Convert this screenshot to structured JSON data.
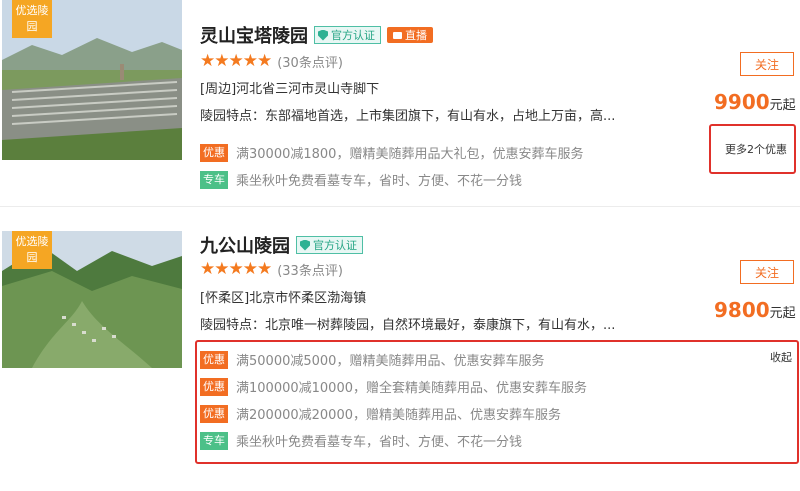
{
  "cards": [
    {
      "tag": "优选陵园",
      "name": "灵山宝塔陵园",
      "auth_label": "官方认证",
      "live_label": "直播",
      "stars": "★★★★★",
      "reviews": "(30条点评)",
      "address": "[周边]河北省三河市灵山寺脚下",
      "feature": "陵园特点：东部福地首选，上市集团旗下，有山有水，占地上万亩，高...",
      "promos": [
        {
          "label": "优惠",
          "text": "满30000减1800，赠精美随葬用品大礼包，优惠安葬车服务"
        },
        {
          "label": "专车",
          "text": "乘坐秋叶免费看墓专车，省时、方便、不花一分钱"
        }
      ],
      "follow": "关注",
      "price": "9900",
      "price_unit": "元起",
      "more": "更多2个优惠"
    },
    {
      "tag": "优选陵园",
      "name": "九公山陵园",
      "auth_label": "官方认证",
      "stars": "★★★★★",
      "reviews": "(33条点评)",
      "address": "[怀柔区]北京市怀柔区渤海镇",
      "feature": "陵园特点：北京唯一树葬陵园，自然环境最好，泰康旗下，有山有水，...",
      "promos": [
        {
          "label": "优惠",
          "text": "满50000减5000，赠精美随葬用品、优惠安葬车服务"
        },
        {
          "label": "优惠",
          "text": "满100000减10000，赠全套精美随葬用品、优惠安葬车服务"
        },
        {
          "label": "优惠",
          "text": "满200000减20000，赠精美随葬用品、优惠安葬车服务"
        },
        {
          "label": "专车",
          "text": "乘坐秋叶免费看墓专车，省时、方便、不花一分钱"
        }
      ],
      "follow": "关注",
      "price": "9800",
      "price_unit": "元起",
      "collapse": "收起"
    }
  ],
  "colors": {
    "accent": "#f26d22",
    "green": "#4cc088",
    "highlight": "#e0312b",
    "tag": "#f5a623"
  }
}
